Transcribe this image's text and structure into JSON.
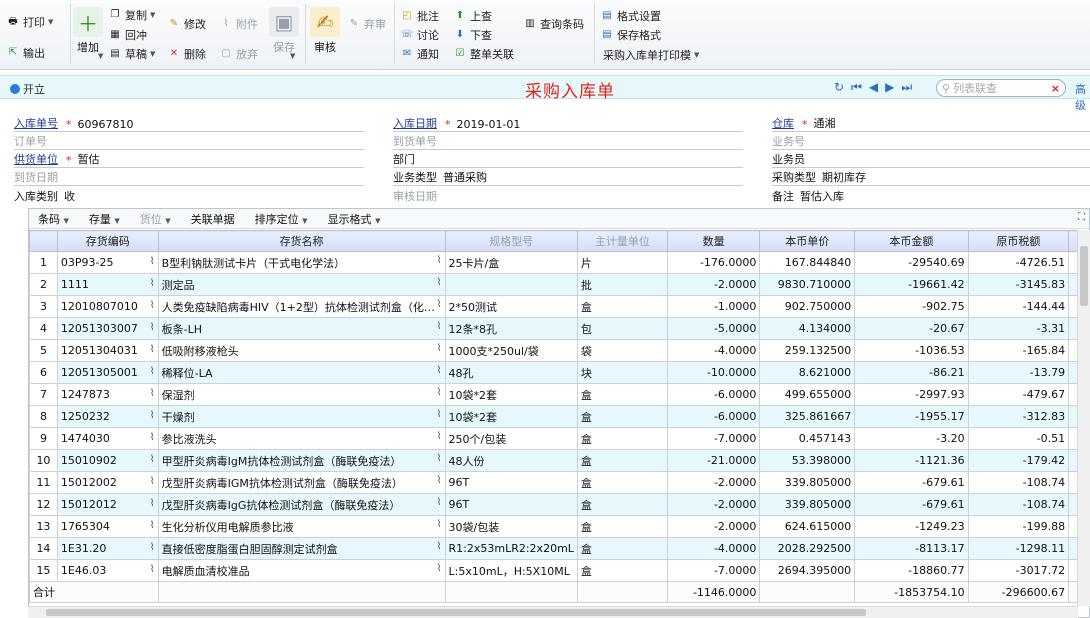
{
  "toolbar": {
    "print": "打印",
    "export": "输出",
    "add": "增加",
    "copy": "复制",
    "write_off": "回冲",
    "draft": "草稿",
    "modify": "修改",
    "delete": "删除",
    "attach": "附件",
    "abandon": "放弃",
    "save": "保存",
    "audit": "审核",
    "unaudit": "弃审",
    "approve": "批注",
    "discuss": "讨论",
    "notify": "通知",
    "prev": "上查",
    "next": "下查",
    "relate": "整单关联",
    "barcode": "查询条码",
    "format_settings": "格式设置",
    "save_format": "保存格式",
    "print_template": "采购入库单打印模"
  },
  "header": {
    "title": "采购入库单",
    "open": "开立",
    "search_placeholder": "列表联查",
    "advanced": "高级"
  },
  "form": {
    "receipt_no_label": "入库单号",
    "receipt_no": "60967810",
    "receipt_date_label": "入库日期",
    "receipt_date": "2019-01-01",
    "warehouse_label": "仓库",
    "warehouse": "通湘",
    "order_no_label": "订单号",
    "arrival_no_label": "到货单号",
    "business_no_label": "业务号",
    "supplier_label": "供货单位",
    "supplier": "暂估",
    "dept_label": "部门",
    "clerk_label": "业务员",
    "arrival_date_label": "到货日期",
    "biz_type_label": "业务类型",
    "biz_type": "普通采购",
    "purchase_type_label": "采购类型",
    "purchase_type": "期初库存",
    "in_type_label": "入库类别",
    "in_type": "收",
    "audit_date_label": "审核日期",
    "remark_label": "备注",
    "remark": "暂估入库"
  },
  "grid_toolbar": {
    "barcode": "条码",
    "inventory": "存量",
    "slot": "货位",
    "related": "关联单据",
    "sort": "排序定位",
    "display": "显示格式"
  },
  "columns": [
    "存货编码",
    "存货名称",
    "规格型号",
    "主计量单位",
    "数量",
    "本币单价",
    "本币金额",
    "原币税额"
  ],
  "rows": [
    {
      "n": "1",
      "code": "03P93-25",
      "name": "B型利钠肽测试卡片（干式电化学法）",
      "spec": "25卡片/盒",
      "unit": "片",
      "qty": "-176.0000",
      "price": "167.844840",
      "amount": "-29540.69",
      "tax": "-4726.51"
    },
    {
      "n": "2",
      "code": "1111",
      "name": "测定品",
      "spec": "",
      "unit": "批",
      "qty": "-2.0000",
      "price": "9830.710000",
      "amount": "-19661.42",
      "tax": "-3145.83"
    },
    {
      "n": "3",
      "code": "12010807010",
      "name": "人类免疫缺陷病毒HIV（1+2型）抗体检测试剂盒（化…",
      "spec": "2*50测试",
      "unit": "盒",
      "qty": "-1.0000",
      "price": "902.750000",
      "amount": "-902.75",
      "tax": "-144.44"
    },
    {
      "n": "4",
      "code": "12051303007",
      "name": "板条-LH",
      "spec": "12条*8孔",
      "unit": "包",
      "qty": "-5.0000",
      "price": "4.134000",
      "amount": "-20.67",
      "tax": "-3.31"
    },
    {
      "n": "5",
      "code": "12051304031",
      "name": "低吸附移液枪头",
      "spec": "1000支*250ul/袋",
      "unit": "袋",
      "qty": "-4.0000",
      "price": "259.132500",
      "amount": "-1036.53",
      "tax": "-165.84"
    },
    {
      "n": "6",
      "code": "12051305001",
      "name": "稀释位-LA",
      "spec": "48孔",
      "unit": "块",
      "qty": "-10.0000",
      "price": "8.621000",
      "amount": "-86.21",
      "tax": "-13.79"
    },
    {
      "n": "7",
      "code": "1247873",
      "name": "保湿剂",
      "spec": "10袋*2套",
      "unit": "盒",
      "qty": "-6.0000",
      "price": "499.655000",
      "amount": "-2997.93",
      "tax": "-479.67"
    },
    {
      "n": "8",
      "code": "1250232",
      "name": "干燥剂",
      "spec": "10袋*2套",
      "unit": "盒",
      "qty": "-6.0000",
      "price": "325.861667",
      "amount": "-1955.17",
      "tax": "-312.83"
    },
    {
      "n": "9",
      "code": "1474030",
      "name": "参比液洗头",
      "spec": "250个/包装",
      "unit": "盒",
      "qty": "-7.0000",
      "price": "0.457143",
      "amount": "-3.20",
      "tax": "-0.51"
    },
    {
      "n": "10",
      "code": "15010902",
      "name": "甲型肝炎病毒IgM抗体检测试剂盒（酶联免疫法）",
      "spec": "48人份",
      "unit": "盒",
      "qty": "-21.0000",
      "price": "53.398000",
      "amount": "-1121.36",
      "tax": "-179.42"
    },
    {
      "n": "11",
      "code": "15012002",
      "name": "戊型肝炎病毒IGM抗体检测试剂盒（酶联免疫法）",
      "spec": "96T",
      "unit": "盒",
      "qty": "-2.0000",
      "price": "339.805000",
      "amount": "-679.61",
      "tax": "-108.74"
    },
    {
      "n": "12",
      "code": "15012012",
      "name": "戊型肝炎病毒IgG抗体检测试剂盒（酶联免疫法）",
      "spec": "96T",
      "unit": "盒",
      "qty": "-2.0000",
      "price": "339.805000",
      "amount": "-679.61",
      "tax": "-108.74"
    },
    {
      "n": "13",
      "code": "1765304",
      "name": "生化分析仪用电解质参比液",
      "spec": "30袋/包装",
      "unit": "盒",
      "qty": "-2.0000",
      "price": "624.615000",
      "amount": "-1249.23",
      "tax": "-199.88"
    },
    {
      "n": "14",
      "code": "1E31.20",
      "name": "直接低密度脂蛋白胆固醇测定试剂盒",
      "spec": "R1:2x53mLR2:2x20mL",
      "unit": "盒",
      "qty": "-4.0000",
      "price": "2028.292500",
      "amount": "-8113.17",
      "tax": "-1298.11"
    },
    {
      "n": "15",
      "code": "1E46.03",
      "name": "电解质血清校准品",
      "spec": "L:5x10mL，H:5X10ML",
      "unit": "盒",
      "qty": "-7.0000",
      "price": "2694.395000",
      "amount": "-18860.77",
      "tax": "-3017.72"
    }
  ],
  "totals": {
    "label": "合计",
    "qty": "-1146.0000",
    "amount": "-1853754.10",
    "tax": "-296600.67"
  }
}
